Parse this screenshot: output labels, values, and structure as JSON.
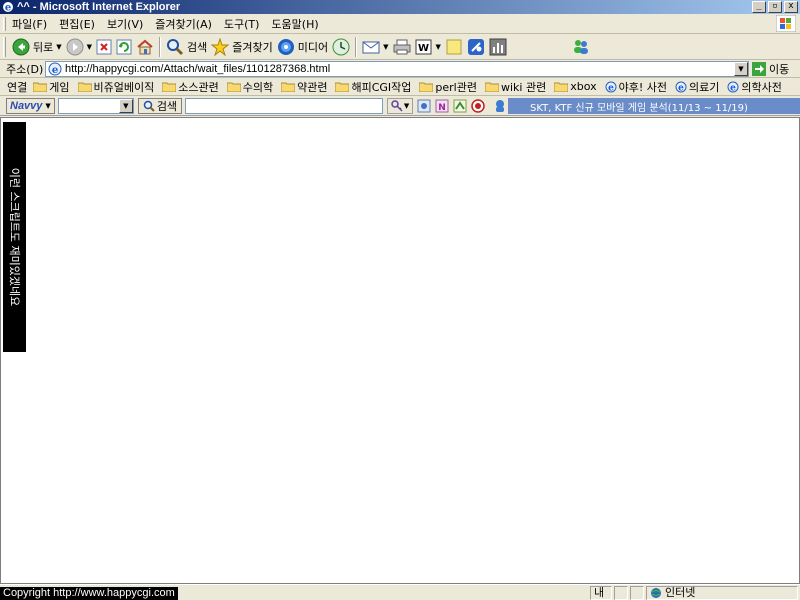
{
  "window": {
    "title": "^^ - Microsoft Internet Explorer"
  },
  "titlebar_buttons": {
    "minimize": "_",
    "restore": "▫",
    "close": "x"
  },
  "menu": [
    "파일(F)",
    "편집(E)",
    "보기(V)",
    "즐겨찾기(A)",
    "도구(T)",
    "도움말(H)"
  ],
  "toolbar": {
    "back_label": "뒤로",
    "search_label": "검색",
    "favorites_label": "즐겨찾기",
    "media_label": "미디어"
  },
  "address": {
    "label": "주소(D)",
    "url": "http://happycgi.com/Attach/wait_files/1101287368.html",
    "go_label": "이동"
  },
  "links": {
    "label": "연결",
    "items": [
      {
        "label": "게임",
        "icon": "folder-icon"
      },
      {
        "label": "비쥬얼베이직",
        "icon": "folder-icon"
      },
      {
        "label": "소스관련",
        "icon": "folder-icon"
      },
      {
        "label": "수의학",
        "icon": "folder-icon"
      },
      {
        "label": "약관련",
        "icon": "folder-icon"
      },
      {
        "label": "해피CGI작업",
        "icon": "folder-icon"
      },
      {
        "label": "perl관련",
        "icon": "folder-icon"
      },
      {
        "label": "wiki 관련",
        "icon": "folder-icon"
      },
      {
        "label": "xbox",
        "icon": "folder-icon"
      },
      {
        "label": "야후! 사전",
        "icon": "ie-page-icon"
      },
      {
        "label": "의료기",
        "icon": "ie-page-icon"
      },
      {
        "label": "의학사전",
        "icon": "ie-page-icon"
      }
    ]
  },
  "navvy": {
    "brand": "Navvy",
    "search_label": "검색",
    "news": "SKT, KTF 신규 모바일 게임 분석(11/13 ~ 11/19)"
  },
  "content": {
    "vertical_text": "이런 스크립트도 재미있겠네요"
  },
  "status": {
    "copyright": "Copyright   http://www.happycgi.com",
    "panel": "내",
    "zone": "인터넷"
  },
  "colors": {
    "titlebar_start": "#0a246a",
    "titlebar_end": "#a6caf0",
    "chrome": "#ece9d8",
    "news_bg": "#6a8cc8"
  }
}
